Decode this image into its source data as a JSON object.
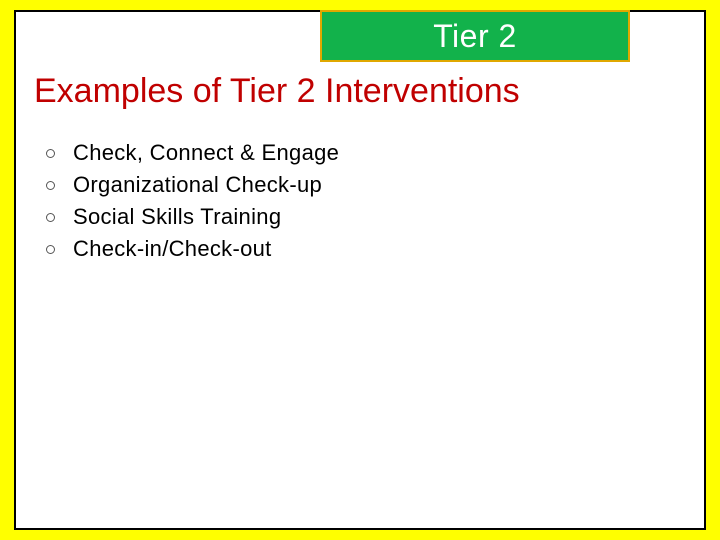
{
  "badge": "Tier 2",
  "title": "Examples of Tier 2 Interventions",
  "items": [
    "Check, Connect & Engage",
    "Organizational Check-up",
    "Social Skills Training",
    "Check-in/Check-out"
  ]
}
